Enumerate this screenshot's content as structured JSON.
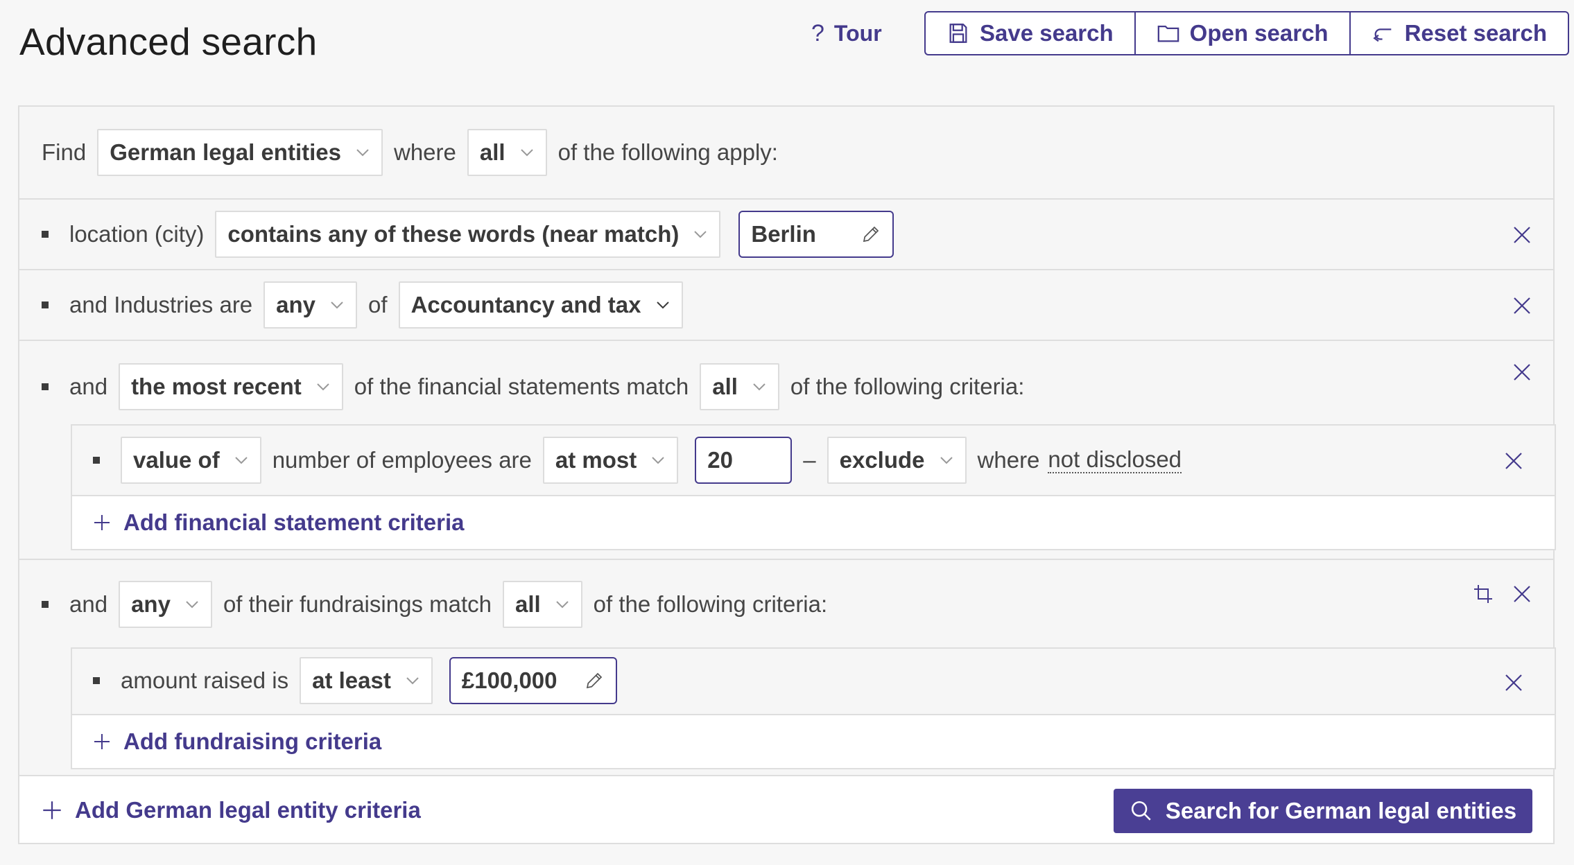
{
  "title": "Advanced search",
  "header": {
    "tour_icon": "?",
    "tour_label": "Tour",
    "save_label": "Save search",
    "open_label": "Open search",
    "reset_label": "Reset search"
  },
  "find_row": {
    "find_label": "Find",
    "entity_value": "German legal entities",
    "where_label": "where",
    "match_value": "all",
    "suffix": "of the following apply:"
  },
  "criteria": {
    "location": {
      "label": "location (city)",
      "operator": "contains any of these words (near match)",
      "value": "Berlin"
    },
    "industries": {
      "prefix": "and Industries are",
      "quantifier": "any",
      "of_label": "of",
      "value": "Accountancy and tax"
    },
    "financial": {
      "and_label": "and",
      "scope": "the most recent",
      "middle": "of the financial statements match",
      "match": "all",
      "suffix": "of the following criteria:",
      "sub": {
        "measure": "value of",
        "field": "number of employees are",
        "comparator": "at most",
        "value": "20",
        "dash": "–",
        "undisclosed": "exclude",
        "where": "where",
        "not_disclosed": "not disclosed"
      },
      "add_label": "Add financial statement criteria"
    },
    "fundraising": {
      "and_label": "and",
      "scope": "any",
      "middle": "of their fundraisings match",
      "match": "all",
      "suffix": "of the following criteria:",
      "sub": {
        "field": "amount raised is",
        "comparator": "at least",
        "value": "£100,000"
      },
      "add_label": "Add fundraising criteria"
    }
  },
  "footer": {
    "add_label": "Add German legal entity criteria",
    "search_label": "Search for German legal entities"
  },
  "colors": {
    "accent": "#443a8c",
    "button_bg": "#4a3f94",
    "border": "#dedede",
    "background": "#f7f7f7"
  }
}
